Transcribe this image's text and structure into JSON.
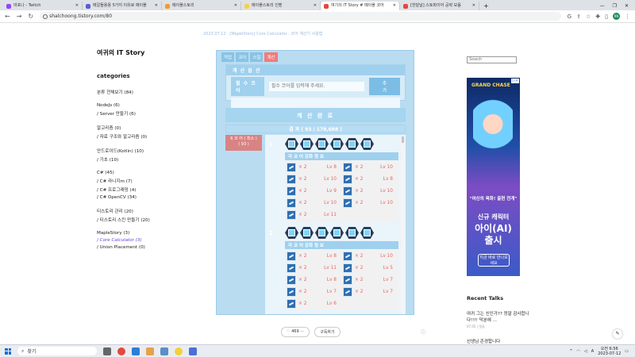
{
  "browser": {
    "tabs": [
      {
        "label": "마포나 - Twitch",
        "color": "#9146ff",
        "active": false
      },
      {
        "label": "메갈들용용 5가지 이유로 메이플",
        "color": "#5b5bd6",
        "active": false
      },
      {
        "label": "메이플스토리",
        "color": "#f29a2e",
        "active": false
      },
      {
        "label": "메이플스토리 인벤",
        "color": "#f7d046",
        "active": false
      },
      {
        "label": "여기의 IT Story # 메이플 코어",
        "color": "#e8453c",
        "active": true
      },
      {
        "label": "[한달날] 스토파이어 공략 모음",
        "color": "#e8453c",
        "active": false
      }
    ],
    "url": "shalchoong.tistory.com/80",
    "profile_initials": "RN"
  },
  "blog": {
    "title": "여귀의 IT Story",
    "categories_heading": "categories",
    "top_post_text": "2023.07.12 · [MapleStory] Core Calculator · 코어 계산기 사용법",
    "categories": [
      {
        "label": "분류 전체보기 (84)",
        "subs": []
      },
      {
        "label": "NodeJs (6)",
        "subs": [
          {
            "label": "/ Server 만들기 (6)",
            "current": false
          }
        ]
      },
      {
        "label": "알고리즘 (0)",
        "subs": [
          {
            "label": "/ 자료 구조와 알고리즘 (0)",
            "current": false
          }
        ]
      },
      {
        "label": "안드로이드(Kotlin) (10)",
        "subs": [
          {
            "label": "/ 기초 (10)",
            "current": false
          }
        ]
      },
      {
        "label": "C# (45)",
        "subs": [
          {
            "label": "/ C# 라니지m (7)",
            "current": false
          },
          {
            "label": "/ C# 프로그래밍 (4)",
            "current": false
          },
          {
            "label": "/ C# OpenCV (34)",
            "current": false
          }
        ]
      },
      {
        "label": "티스토리 관리 (20)",
        "subs": [
          {
            "label": "/ 티스토리 스킨 만들기 (20)",
            "current": false
          }
        ]
      },
      {
        "label": "MapleStory (3)",
        "subs": [
          {
            "label": "/ Core Calculator (3)",
            "current": true
          },
          {
            "label": "/ Union Placement (0)",
            "current": false
          }
        ]
      }
    ]
  },
  "calculator": {
    "tabs": [
      "직업",
      "코어",
      "스킬",
      "계산"
    ],
    "active_tab": 3,
    "options_heading": "계 산 옵 션",
    "required_core_label": "필 수 코 어",
    "required_core_placeholder": "필수 코어를 입력해 주세요.",
    "add_button": "추 가",
    "done_label": "계 산 완 료",
    "result_count": "결 과 ( 93 / 178,688 )",
    "combo_tag_line1": "6 코 어 ( 최소 )",
    "combo_tag_line2": "( 93 )",
    "combos": [
      {
        "index": "1",
        "section_heading": "각 코 어 강화 정 보",
        "rows": [
          [
            {
              "mult": "× 2",
              "lv": "Lv 8"
            },
            {
              "mult": "× 2",
              "lv": "Lv 10"
            }
          ],
          [
            {
              "mult": "× 2",
              "lv": "Lv 10"
            },
            {
              "mult": "× 2",
              "lv": "Lv 8"
            }
          ],
          [
            {
              "mult": "× 2",
              "lv": "Lv 9"
            },
            {
              "mult": "× 2",
              "lv": "Lv 10"
            }
          ],
          [
            {
              "mult": "× 2",
              "lv": "Lv 10"
            },
            {
              "mult": "× 2",
              "lv": "Lv 10"
            }
          ],
          [
            {
              "mult": "× 2",
              "lv": "Lv 11"
            }
          ]
        ]
      },
      {
        "index": "2",
        "section_heading": "각 코 어 강화 정 보",
        "rows": [
          [
            {
              "mult": "× 2",
              "lv": "Lv 8"
            },
            {
              "mult": "× 2",
              "lv": "Lv 10"
            }
          ],
          [
            {
              "mult": "× 2",
              "lv": "Lv 11"
            },
            {
              "mult": "× 2",
              "lv": "Lv 5"
            }
          ],
          [
            {
              "mult": "× 2",
              "lv": "Lv 8"
            },
            {
              "mult": "× 2",
              "lv": "Lv 7"
            }
          ],
          [
            {
              "mult": "× 2",
              "lv": "Lv 7"
            },
            {
              "mult": "× 2",
              "lv": "Lv 7"
            }
          ],
          [
            {
              "mult": "× 2",
              "lv": "Lv 6"
            }
          ]
        ]
      }
    ]
  },
  "right": {
    "search_placeholder": "Search",
    "ad": {
      "logo": "GRAND CHASE",
      "line1": "\"여신의 육화! 출현 전개\"",
      "line2": "신규 캐릭터",
      "line3": "아이(AI)",
      "line4": "출시",
      "button": "지금 바로 만나보세요"
    },
    "recent_heading": "Recent Talks",
    "recent": [
      {
        "text": "여귀 그는 신인가?? 정말 감사합니다!!!! 덕분에 …",
        "meta": "07.05 | 댓글"
      },
      {
        "text": "선생님 존경합니다",
        "meta": ""
      }
    ]
  },
  "footer": {
    "likes": "469",
    "subscribe": "구독하기"
  },
  "taskbar": {
    "search_label": "찾기",
    "time": "오전 6:56",
    "date": "2023-07-12",
    "lang": "A"
  }
}
